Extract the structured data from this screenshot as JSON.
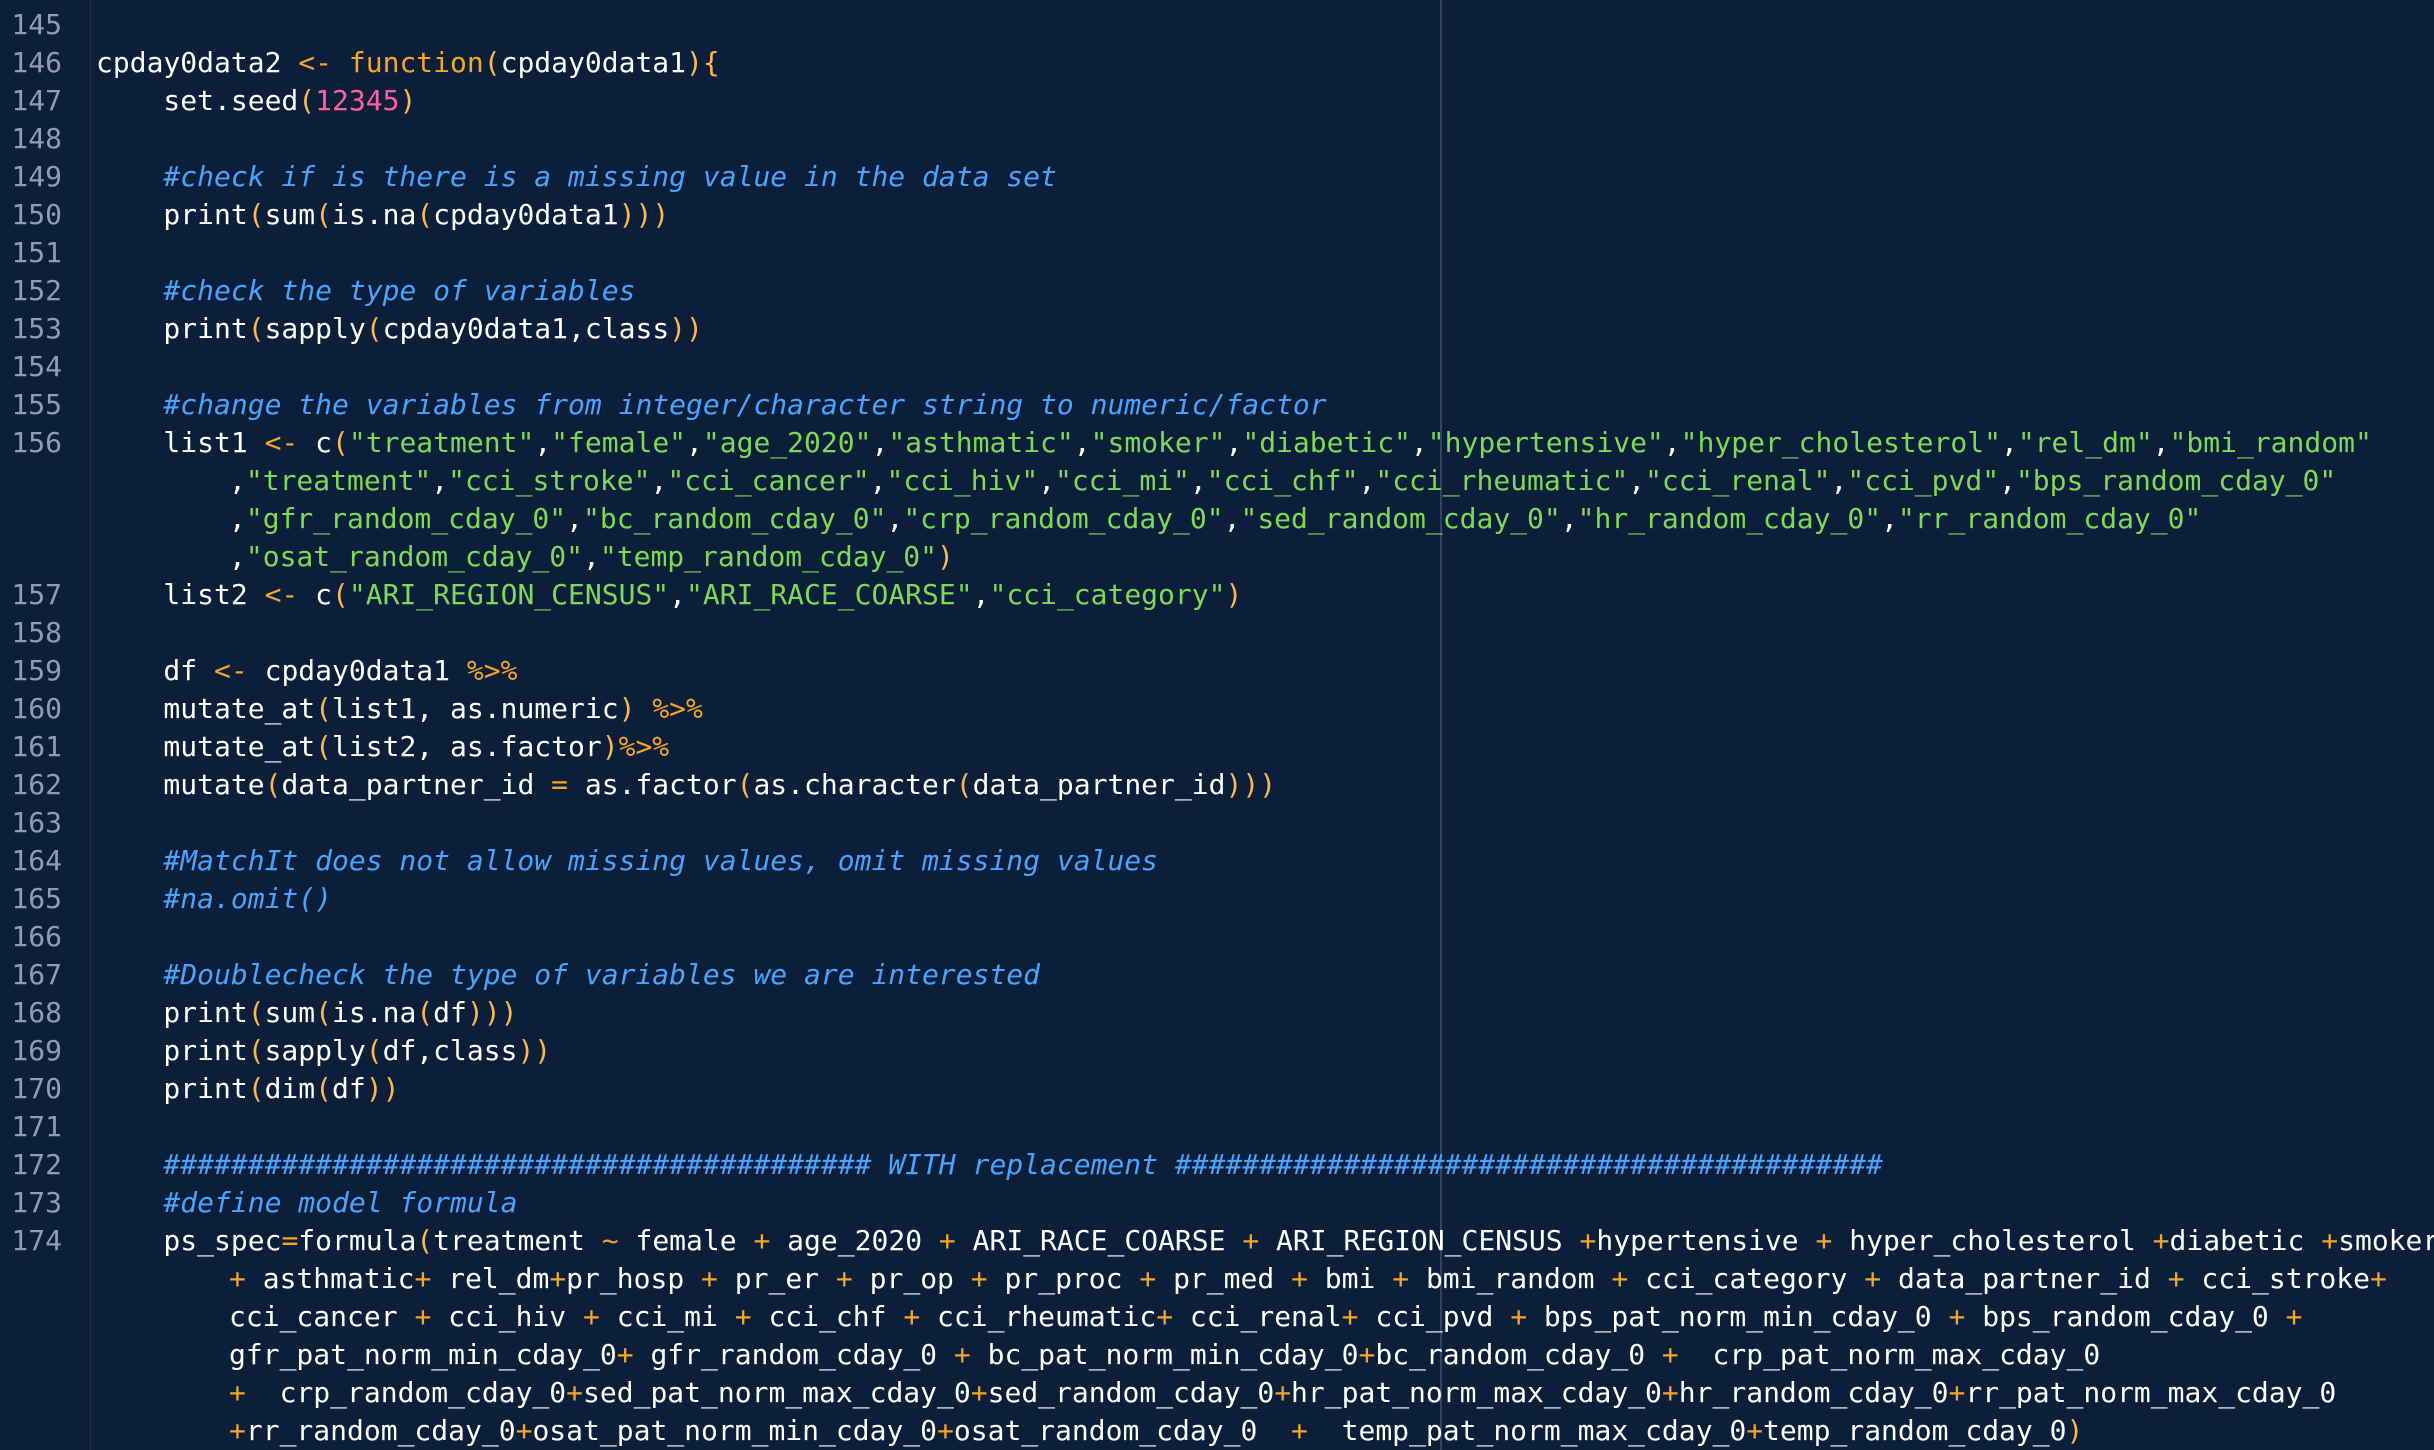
{
  "theme": {
    "background": "#0b1f3b",
    "gutter_text": "#8d9db3",
    "plain": "#ffffff",
    "keyword": "#f5a623",
    "string": "#7ed957",
    "number": "#ff5fa2",
    "comment": "#4aa3ff"
  },
  "lines": [
    {
      "num": "145",
      "tokens": []
    },
    {
      "num": "146",
      "tokens": [
        {
          "t": "plain",
          "v": "cpday0data2 "
        },
        {
          "t": "op",
          "v": "<-"
        },
        {
          "t": "plain",
          "v": " "
        },
        {
          "t": "kw",
          "v": "function"
        },
        {
          "t": "paren",
          "v": "("
        },
        {
          "t": "plain",
          "v": "cpday0data1"
        },
        {
          "t": "paren",
          "v": "){"
        }
      ]
    },
    {
      "num": "147",
      "tokens": [
        {
          "t": "plain",
          "v": "    set.seed"
        },
        {
          "t": "paren",
          "v": "("
        },
        {
          "t": "num",
          "v": "12345"
        },
        {
          "t": "paren",
          "v": ")"
        }
      ]
    },
    {
      "num": "148",
      "tokens": []
    },
    {
      "num": "149",
      "tokens": [
        {
          "t": "comment",
          "v": "    #check if is there is a missing value in the data set"
        }
      ]
    },
    {
      "num": "150",
      "tokens": [
        {
          "t": "plain",
          "v": "    print"
        },
        {
          "t": "paren",
          "v": "("
        },
        {
          "t": "plain",
          "v": "sum"
        },
        {
          "t": "paren",
          "v": "("
        },
        {
          "t": "plain",
          "v": "is.na"
        },
        {
          "t": "paren",
          "v": "("
        },
        {
          "t": "plain",
          "v": "cpday0data1"
        },
        {
          "t": "paren",
          "v": ")))"
        }
      ]
    },
    {
      "num": "151",
      "tokens": []
    },
    {
      "num": "152",
      "tokens": [
        {
          "t": "comment",
          "v": "    #check the type of variables"
        }
      ]
    },
    {
      "num": "153",
      "tokens": [
        {
          "t": "plain",
          "v": "    print"
        },
        {
          "t": "paren",
          "v": "("
        },
        {
          "t": "plain",
          "v": "sapply"
        },
        {
          "t": "paren",
          "v": "("
        },
        {
          "t": "plain",
          "v": "cpday0data1,class"
        },
        {
          "t": "paren",
          "v": "))"
        }
      ]
    },
    {
      "num": "154",
      "tokens": []
    },
    {
      "num": "155",
      "tokens": [
        {
          "t": "comment",
          "v": "    #change the variables from integer/character string to numeric/factor"
        }
      ]
    },
    {
      "num": "156",
      "tokens": [
        {
          "t": "plain",
          "v": "    list1 "
        },
        {
          "t": "op",
          "v": "<-"
        },
        {
          "t": "plain",
          "v": " c"
        },
        {
          "t": "paren",
          "v": "("
        },
        {
          "t": "str",
          "v": "\"treatment\""
        },
        {
          "t": "plain",
          "v": ","
        },
        {
          "t": "str",
          "v": "\"female\""
        },
        {
          "t": "plain",
          "v": ","
        },
        {
          "t": "str",
          "v": "\"age_2020\""
        },
        {
          "t": "plain",
          "v": ","
        },
        {
          "t": "str",
          "v": "\"asthmatic\""
        },
        {
          "t": "plain",
          "v": ","
        },
        {
          "t": "str",
          "v": "\"smoker\""
        },
        {
          "t": "plain",
          "v": ","
        },
        {
          "t": "str",
          "v": "\"diabetic\""
        },
        {
          "t": "plain",
          "v": ","
        },
        {
          "t": "str",
          "v": "\"hypertensive\""
        },
        {
          "t": "plain",
          "v": ","
        },
        {
          "t": "str",
          "v": "\"hyper_cholesterol\""
        },
        {
          "t": "plain",
          "v": ","
        },
        {
          "t": "str",
          "v": "\"rel_dm\""
        },
        {
          "t": "plain",
          "v": ","
        },
        {
          "t": "str",
          "v": "\"bmi_random\""
        }
      ]
    },
    {
      "num": "",
      "wrap": true,
      "tokens": [
        {
          "t": "plain",
          "v": ","
        },
        {
          "t": "str",
          "v": "\"treatment\""
        },
        {
          "t": "plain",
          "v": ","
        },
        {
          "t": "str",
          "v": "\"cci_stroke\""
        },
        {
          "t": "plain",
          "v": ","
        },
        {
          "t": "str",
          "v": "\"cci_cancer\""
        },
        {
          "t": "plain",
          "v": ","
        },
        {
          "t": "str",
          "v": "\"cci_hiv\""
        },
        {
          "t": "plain",
          "v": ","
        },
        {
          "t": "str",
          "v": "\"cci_mi\""
        },
        {
          "t": "plain",
          "v": ","
        },
        {
          "t": "str",
          "v": "\"cci_chf\""
        },
        {
          "t": "plain",
          "v": ","
        },
        {
          "t": "str",
          "v": "\"cci_rheumatic\""
        },
        {
          "t": "plain",
          "v": ","
        },
        {
          "t": "str",
          "v": "\"cci_renal\""
        },
        {
          "t": "plain",
          "v": ","
        },
        {
          "t": "str",
          "v": "\"cci_pvd\""
        },
        {
          "t": "plain",
          "v": ","
        },
        {
          "t": "str",
          "v": "\"bps_random_cday_0\""
        }
      ]
    },
    {
      "num": "",
      "wrap": true,
      "tokens": [
        {
          "t": "plain",
          "v": ","
        },
        {
          "t": "str",
          "v": "\"gfr_random_cday_0\""
        },
        {
          "t": "plain",
          "v": ","
        },
        {
          "t": "str",
          "v": "\"bc_random_cday_0\""
        },
        {
          "t": "plain",
          "v": ","
        },
        {
          "t": "str",
          "v": "\"crp_random_cday_0\""
        },
        {
          "t": "plain",
          "v": ","
        },
        {
          "t": "str",
          "v": "\"sed_random_cday_0\""
        },
        {
          "t": "plain",
          "v": ","
        },
        {
          "t": "str",
          "v": "\"hr_random_cday_0\""
        },
        {
          "t": "plain",
          "v": ","
        },
        {
          "t": "str",
          "v": "\"rr_random_cday_0\""
        }
      ]
    },
    {
      "num": "",
      "wrap": true,
      "tokens": [
        {
          "t": "plain",
          "v": ","
        },
        {
          "t": "str",
          "v": "\"osat_random_cday_0\""
        },
        {
          "t": "plain",
          "v": ","
        },
        {
          "t": "str",
          "v": "\"temp_random_cday_0\""
        },
        {
          "t": "paren",
          "v": ")"
        }
      ]
    },
    {
      "num": "157",
      "tokens": [
        {
          "t": "plain",
          "v": "    list2 "
        },
        {
          "t": "op",
          "v": "<-"
        },
        {
          "t": "plain",
          "v": " c"
        },
        {
          "t": "paren",
          "v": "("
        },
        {
          "t": "str",
          "v": "\"ARI_REGION_CENSUS\""
        },
        {
          "t": "plain",
          "v": ","
        },
        {
          "t": "str",
          "v": "\"ARI_RACE_COARSE\""
        },
        {
          "t": "plain",
          "v": ","
        },
        {
          "t": "str",
          "v": "\"cci_category\""
        },
        {
          "t": "paren",
          "v": ")"
        }
      ]
    },
    {
      "num": "158",
      "tokens": []
    },
    {
      "num": "159",
      "tokens": [
        {
          "t": "plain",
          "v": "    df "
        },
        {
          "t": "op",
          "v": "<-"
        },
        {
          "t": "plain",
          "v": " cpday0data1 "
        },
        {
          "t": "op",
          "v": "%>%"
        }
      ]
    },
    {
      "num": "160",
      "tokens": [
        {
          "t": "plain",
          "v": "    mutate_at"
        },
        {
          "t": "paren",
          "v": "("
        },
        {
          "t": "plain",
          "v": "list1, as.numeric"
        },
        {
          "t": "paren",
          "v": ")"
        },
        {
          "t": "plain",
          "v": " "
        },
        {
          "t": "op",
          "v": "%>%"
        }
      ]
    },
    {
      "num": "161",
      "tokens": [
        {
          "t": "plain",
          "v": "    mutate_at"
        },
        {
          "t": "paren",
          "v": "("
        },
        {
          "t": "plain",
          "v": "list2, as.factor"
        },
        {
          "t": "paren",
          "v": ")"
        },
        {
          "t": "op",
          "v": "%>%"
        }
      ]
    },
    {
      "num": "162",
      "tokens": [
        {
          "t": "plain",
          "v": "    mutate"
        },
        {
          "t": "paren",
          "v": "("
        },
        {
          "t": "plain",
          "v": "data_partner_id "
        },
        {
          "t": "op",
          "v": "="
        },
        {
          "t": "plain",
          "v": " as.factor"
        },
        {
          "t": "paren",
          "v": "("
        },
        {
          "t": "plain",
          "v": "as.character"
        },
        {
          "t": "paren",
          "v": "("
        },
        {
          "t": "plain",
          "v": "data_partner_id"
        },
        {
          "t": "paren",
          "v": ")))"
        }
      ]
    },
    {
      "num": "163",
      "tokens": []
    },
    {
      "num": "164",
      "tokens": [
        {
          "t": "comment",
          "v": "    #MatchIt does not allow missing values, omit missing values"
        }
      ]
    },
    {
      "num": "165",
      "tokens": [
        {
          "t": "comment",
          "v": "    #na.omit()"
        }
      ]
    },
    {
      "num": "166",
      "tokens": []
    },
    {
      "num": "167",
      "tokens": [
        {
          "t": "comment",
          "v": "    #Doublecheck the type of variables we are interested"
        }
      ]
    },
    {
      "num": "168",
      "tokens": [
        {
          "t": "plain",
          "v": "    print"
        },
        {
          "t": "paren",
          "v": "("
        },
        {
          "t": "plain",
          "v": "sum"
        },
        {
          "t": "paren",
          "v": "("
        },
        {
          "t": "plain",
          "v": "is.na"
        },
        {
          "t": "paren",
          "v": "("
        },
        {
          "t": "plain",
          "v": "df"
        },
        {
          "t": "paren",
          "v": ")))"
        }
      ]
    },
    {
      "num": "169",
      "tokens": [
        {
          "t": "plain",
          "v": "    print"
        },
        {
          "t": "paren",
          "v": "("
        },
        {
          "t": "plain",
          "v": "sapply"
        },
        {
          "t": "paren",
          "v": "("
        },
        {
          "t": "plain",
          "v": "df,class"
        },
        {
          "t": "paren",
          "v": "))"
        }
      ]
    },
    {
      "num": "170",
      "tokens": [
        {
          "t": "plain",
          "v": "    print"
        },
        {
          "t": "paren",
          "v": "("
        },
        {
          "t": "plain",
          "v": "dim"
        },
        {
          "t": "paren",
          "v": "("
        },
        {
          "t": "plain",
          "v": "df"
        },
        {
          "t": "paren",
          "v": "))"
        }
      ]
    },
    {
      "num": "171",
      "tokens": []
    },
    {
      "num": "172",
      "tokens": [
        {
          "t": "comment",
          "v": "    ########################################## WITH replacement ##########################################"
        }
      ]
    },
    {
      "num": "173",
      "tokens": [
        {
          "t": "comment",
          "v": "    #define model formula"
        }
      ]
    },
    {
      "num": "174",
      "tokens": [
        {
          "t": "plain",
          "v": "    ps_spec"
        },
        {
          "t": "op",
          "v": "="
        },
        {
          "t": "plain",
          "v": "formula"
        },
        {
          "t": "paren",
          "v": "("
        },
        {
          "t": "plain",
          "v": "treatment "
        },
        {
          "t": "op",
          "v": "~"
        },
        {
          "t": "plain",
          "v": " female "
        },
        {
          "t": "op",
          "v": "+"
        },
        {
          "t": "plain",
          "v": " age_2020 "
        },
        {
          "t": "op",
          "v": "+"
        },
        {
          "t": "plain",
          "v": " ARI_RACE_COARSE "
        },
        {
          "t": "op",
          "v": "+"
        },
        {
          "t": "plain",
          "v": " ARI_REGION_CENSUS "
        },
        {
          "t": "op",
          "v": "+"
        },
        {
          "t": "plain",
          "v": "hypertensive "
        },
        {
          "t": "op",
          "v": "+"
        },
        {
          "t": "plain",
          "v": " hyper_cholesterol "
        },
        {
          "t": "op",
          "v": "+"
        },
        {
          "t": "plain",
          "v": "diabetic "
        },
        {
          "t": "op",
          "v": "+"
        },
        {
          "t": "plain",
          "v": "smoker"
        }
      ]
    },
    {
      "num": "",
      "wrap": true,
      "tokens": [
        {
          "t": "op",
          "v": "+"
        },
        {
          "t": "plain",
          "v": " asthmatic"
        },
        {
          "t": "op",
          "v": "+"
        },
        {
          "t": "plain",
          "v": " rel_dm"
        },
        {
          "t": "op",
          "v": "+"
        },
        {
          "t": "plain",
          "v": "pr_hosp "
        },
        {
          "t": "op",
          "v": "+"
        },
        {
          "t": "plain",
          "v": " pr_er "
        },
        {
          "t": "op",
          "v": "+"
        },
        {
          "t": "plain",
          "v": " pr_op "
        },
        {
          "t": "op",
          "v": "+"
        },
        {
          "t": "plain",
          "v": " pr_proc "
        },
        {
          "t": "op",
          "v": "+"
        },
        {
          "t": "plain",
          "v": " pr_med "
        },
        {
          "t": "op",
          "v": "+"
        },
        {
          "t": "plain",
          "v": " bmi "
        },
        {
          "t": "op",
          "v": "+"
        },
        {
          "t": "plain",
          "v": " bmi_random "
        },
        {
          "t": "op",
          "v": "+"
        },
        {
          "t": "plain",
          "v": " cci_category "
        },
        {
          "t": "op",
          "v": "+"
        },
        {
          "t": "plain",
          "v": " data_partner_id "
        },
        {
          "t": "op",
          "v": "+"
        },
        {
          "t": "plain",
          "v": " cci_stroke"
        },
        {
          "t": "op",
          "v": "+"
        }
      ]
    },
    {
      "num": "",
      "wrap": true,
      "tokens": [
        {
          "t": "plain",
          "v": "cci_cancer "
        },
        {
          "t": "op",
          "v": "+"
        },
        {
          "t": "plain",
          "v": " cci_hiv "
        },
        {
          "t": "op",
          "v": "+"
        },
        {
          "t": "plain",
          "v": " cci_mi "
        },
        {
          "t": "op",
          "v": "+"
        },
        {
          "t": "plain",
          "v": " cci_chf "
        },
        {
          "t": "op",
          "v": "+"
        },
        {
          "t": "plain",
          "v": " cci_rheumatic"
        },
        {
          "t": "op",
          "v": "+"
        },
        {
          "t": "plain",
          "v": " cci_renal"
        },
        {
          "t": "op",
          "v": "+"
        },
        {
          "t": "plain",
          "v": " cci_pvd "
        },
        {
          "t": "op",
          "v": "+"
        },
        {
          "t": "plain",
          "v": " bps_pat_norm_min_cday_0 "
        },
        {
          "t": "op",
          "v": "+"
        },
        {
          "t": "plain",
          "v": " bps_random_cday_0 "
        },
        {
          "t": "op",
          "v": "+"
        }
      ]
    },
    {
      "num": "",
      "wrap": true,
      "tokens": [
        {
          "t": "plain",
          "v": "gfr_pat_norm_min_cday_0"
        },
        {
          "t": "op",
          "v": "+"
        },
        {
          "t": "plain",
          "v": " gfr_random_cday_0 "
        },
        {
          "t": "op",
          "v": "+"
        },
        {
          "t": "plain",
          "v": " bc_pat_norm_min_cday_0"
        },
        {
          "t": "op",
          "v": "+"
        },
        {
          "t": "plain",
          "v": "bc_random_cday_0 "
        },
        {
          "t": "op",
          "v": "+"
        },
        {
          "t": "plain",
          "v": "  crp_pat_norm_max_cday_0"
        }
      ]
    },
    {
      "num": "",
      "wrap": true,
      "tokens": [
        {
          "t": "op",
          "v": "+"
        },
        {
          "t": "plain",
          "v": "  crp_random_cday_0"
        },
        {
          "t": "op",
          "v": "+"
        },
        {
          "t": "plain",
          "v": "sed_pat_norm_max_cday_0"
        },
        {
          "t": "op",
          "v": "+"
        },
        {
          "t": "plain",
          "v": "sed_random_cday_0"
        },
        {
          "t": "op",
          "v": "+"
        },
        {
          "t": "plain",
          "v": "hr_pat_norm_max_cday_0"
        },
        {
          "t": "op",
          "v": "+"
        },
        {
          "t": "plain",
          "v": "hr_random_cday_0"
        },
        {
          "t": "op",
          "v": "+"
        },
        {
          "t": "plain",
          "v": "rr_pat_norm_max_cday_0"
        }
      ]
    },
    {
      "num": "",
      "wrap": true,
      "tokens": [
        {
          "t": "op",
          "v": "+"
        },
        {
          "t": "plain",
          "v": "rr_random_cday_0"
        },
        {
          "t": "op",
          "v": "+"
        },
        {
          "t": "plain",
          "v": "osat_pat_norm_min_cday_0"
        },
        {
          "t": "op",
          "v": "+"
        },
        {
          "t": "plain",
          "v": "osat_random_cday_0  "
        },
        {
          "t": "op",
          "v": "+"
        },
        {
          "t": "plain",
          "v": "  temp_pat_norm_max_cday_0"
        },
        {
          "t": "op",
          "v": "+"
        },
        {
          "t": "plain",
          "v": "temp_random_cday_0"
        },
        {
          "t": "paren",
          "v": ")"
        }
      ]
    }
  ]
}
